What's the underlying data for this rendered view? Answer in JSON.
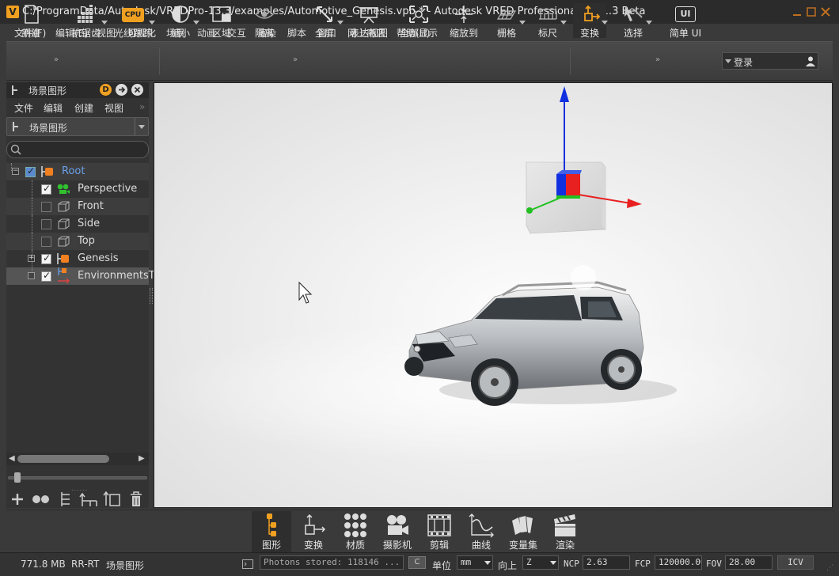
{
  "window": {
    "title": "C:/ProgramData/Autodesk/VREDPro-13.3/examples/Automotive_Genesis.vpb * - Autodesk VRED Professional 2021.3 Beta",
    "logo_letter": "V"
  },
  "menu": [
    "文件(F)",
    "编辑(E)",
    "视图",
    "可视化",
    "场景",
    "动画",
    "交互",
    "渲染",
    "脚本",
    "窗口",
    "网上商店",
    "帮助(H)"
  ],
  "toolbar": {
    "new": "新建",
    "antialias": "抗锯齿",
    "raytrace": "光线跟踪",
    "raytrace_badge": "CPU",
    "shrink": "缩小",
    "region": "区域",
    "isolate": "隔离",
    "fullscreen": "全屏",
    "presentation": "表达视图",
    "show_all": "全部显示",
    "zoom_to": "缩放到",
    "grid": "栅格",
    "ruler": "标尺",
    "transform": "变换",
    "select": "选择",
    "simple_ui": "简单 UI",
    "simple_ui_badge": "UI",
    "login": "登录"
  },
  "scenegraph": {
    "panel_title": "场景图形",
    "menu": [
      "文件",
      "编辑",
      "创建",
      "视图"
    ],
    "dropdown": "场景图形",
    "search_placeholder": "",
    "nodes": {
      "root": "Root",
      "perspective": "Perspective",
      "front": "Front",
      "side": "Side",
      "top": "Top",
      "genesis": "Genesis",
      "environments": "EnvironmentsTr"
    }
  },
  "modules": {
    "graph": "图形",
    "transform": "变换",
    "material": "材质",
    "camera": "摄影机",
    "clip": "剪辑",
    "curve": "曲线",
    "variant": "变量集",
    "render": "渲染"
  },
  "status": {
    "memory": "771.8 MB",
    "mode": "RR-RT",
    "module": "场景图形",
    "photons": "Photons stored: 118146 ...",
    "c_button": "C",
    "unit_label": "单位",
    "unit_value": "mm",
    "up_label": "向上",
    "up_value": "Z",
    "ncp_label": "NCP",
    "ncp_value": "2.63",
    "fcp_label": "FCP",
    "fcp_value": "120000.00",
    "fov_label": "FOV",
    "fov_value": "28.00",
    "icv": "ICV"
  },
  "colors": {
    "accent": "#f0a020",
    "axis_x": "#e82020",
    "axis_y": "#20c020",
    "axis_z": "#1030e0",
    "root_label": "#6aa0e8"
  }
}
